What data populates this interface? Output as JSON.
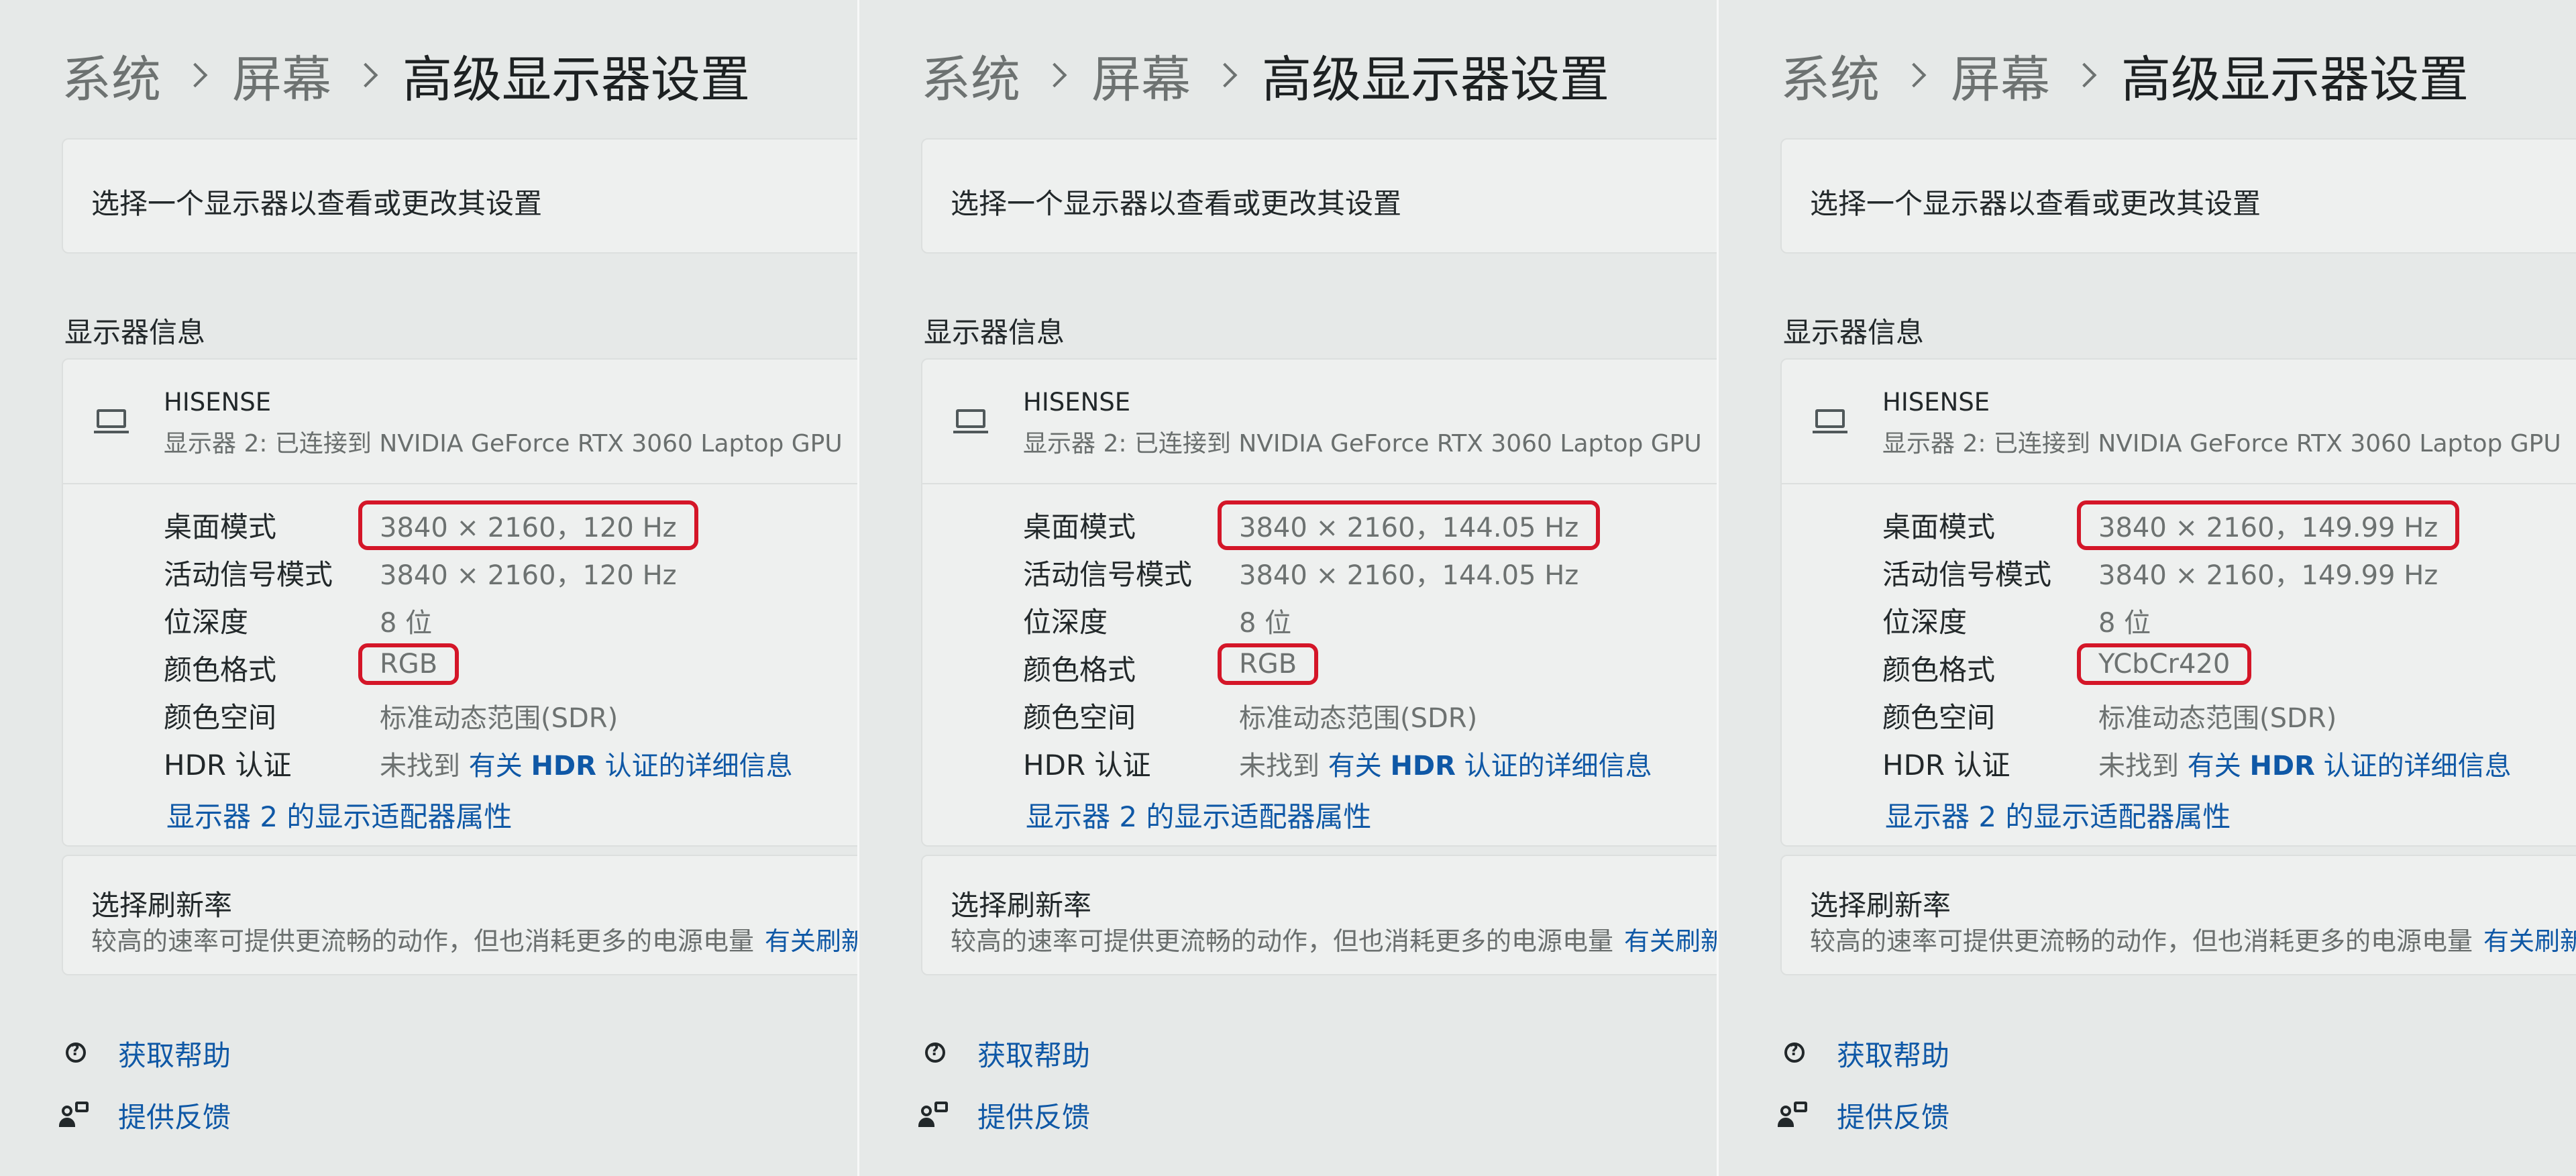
{
  "breadcrumb": {
    "level1": "系统",
    "level2": "屏幕",
    "current": "高级显示器设置"
  },
  "select_display": {
    "label": "选择一个显示器以查看或更改其设置"
  },
  "section_title": "显示器信息",
  "monitor": {
    "name": "HISENSE",
    "description": "显示器 2: 已连接到 NVIDIA GeForce RTX 3060 Laptop GPU",
    "icon": "monitor-icon"
  },
  "labels": {
    "desktop_mode": "桌面模式",
    "active_signal_mode": "活动信号模式",
    "bit_depth": "位深度",
    "color_format": "颜色格式",
    "color_space": "颜色空间",
    "hdr_cert": "HDR 认证"
  },
  "values": {
    "bit_depth": "8 位",
    "color_space": "标准动态范围(SDR)",
    "hdr_not_found": "未找到",
    "hdr_link_prefix": "有关",
    "hdr_link_bold": "HDR",
    "hdr_link_suffix": "认证的详细信息"
  },
  "panels": [
    {
      "desktop_mode": "3840 × 2160，120 Hz",
      "active_signal_mode": "3840 × 2160，120 Hz",
      "color_format": "RGB"
    },
    {
      "desktop_mode": "3840 × 2160，144.05 Hz",
      "active_signal_mode": "3840 × 2160，144.05 Hz",
      "color_format": "RGB"
    },
    {
      "desktop_mode": "3840 × 2160，149.99 Hz",
      "active_signal_mode": "3840 × 2160，149.99 Hz",
      "color_format": "YCbCr420"
    }
  ],
  "adapter_link": "显示器 2 的显示适配器属性",
  "refresh_rate": {
    "title": "选择刷新率",
    "description": "较高的速率可提供更流畅的动作，但也消耗更多的电源电量",
    "link": "有关刷新率"
  },
  "footer": {
    "help": "获取帮助",
    "feedback": "提供反馈",
    "help_icon": "help-icon",
    "feedback_icon": "feedback-icon"
  },
  "colors": {
    "highlight": "#d41628",
    "link": "#0f58a6",
    "background": "#e6e9e8"
  }
}
